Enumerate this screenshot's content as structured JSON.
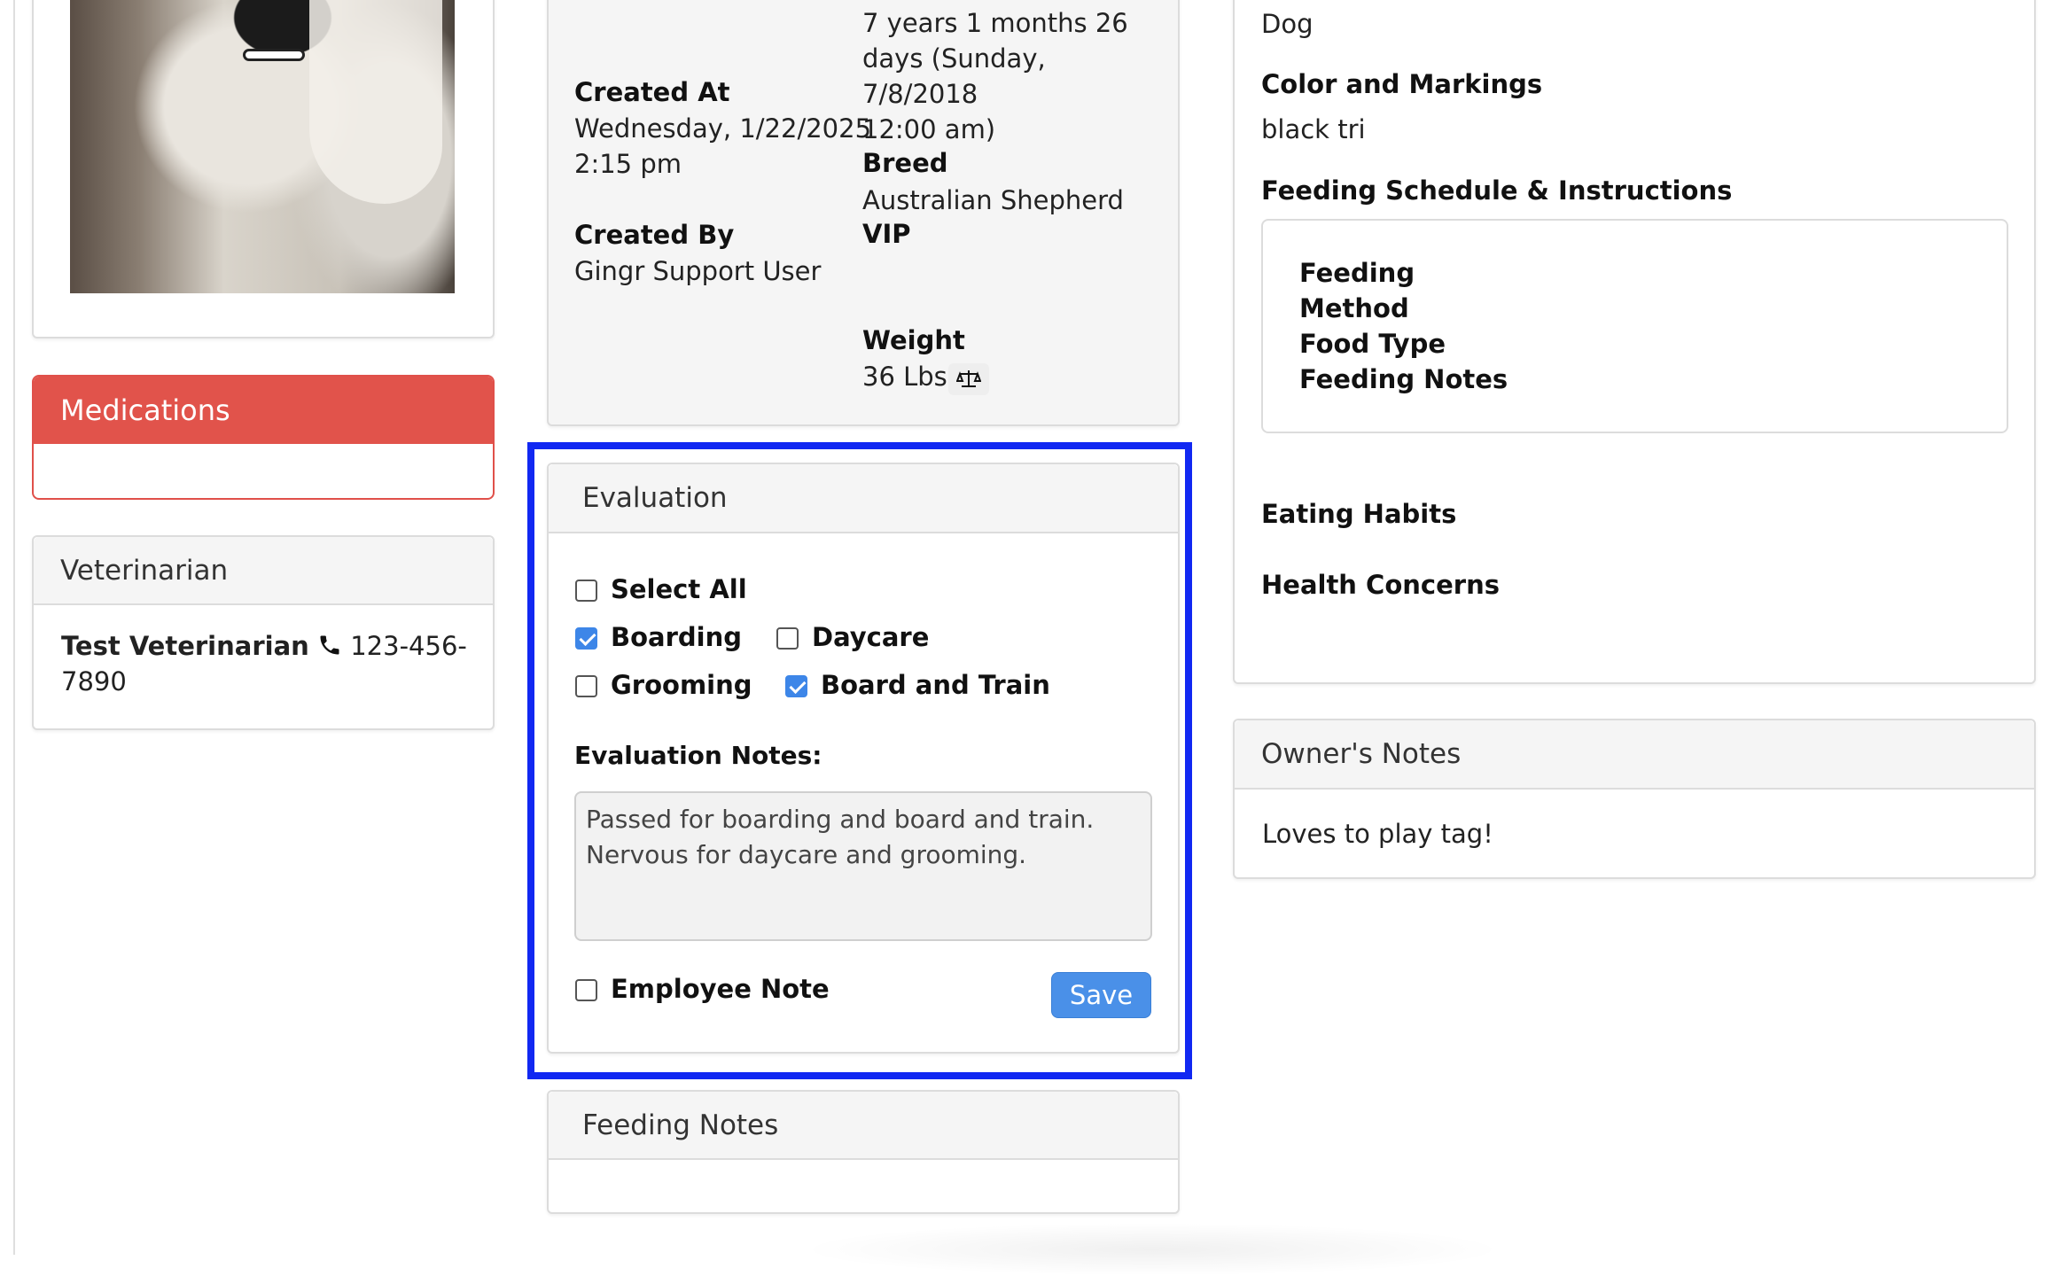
{
  "left": {
    "medications": {
      "title": "Medications"
    },
    "veterinarian": {
      "title": "Veterinarian",
      "name": "Test Veterinarian",
      "phone_line1": "123-456-",
      "phone_line2": "7890"
    }
  },
  "details": {
    "age_line1": "7 years 1 months 26",
    "age_line2": "days (Sunday, 7/8/2018",
    "age_line3": "12:00 am)",
    "created_at_label": "Created At",
    "created_at_line1": "Wednesday, 1/22/2025",
    "created_at_line2": "2:15 pm",
    "created_by_label": "Created By",
    "created_by_value": "Gingr Support User",
    "breed_label": "Breed",
    "breed_value": "Australian Shepherd",
    "vip_label": "VIP",
    "weight_label": "Weight",
    "weight_value": "36 Lbs"
  },
  "evaluation": {
    "title": "Evaluation",
    "options": [
      {
        "label": "Select All",
        "checked": false
      },
      {
        "label": "Boarding",
        "checked": true
      },
      {
        "label": "Daycare",
        "checked": false
      },
      {
        "label": "Grooming",
        "checked": false
      },
      {
        "label": "Board and Train",
        "checked": true
      }
    ],
    "notes_label": "Evaluation Notes:",
    "notes_value": "Passed for boarding and board and train.\nNervous for daycare and grooming.",
    "employee_note_label": "Employee Note",
    "employee_note_checked": false,
    "save_label": "Save"
  },
  "feeding_notes": {
    "title": "Feeding Notes"
  },
  "right": {
    "species_value": "Dog",
    "color_label": "Color and Markings",
    "color_value": "black tri",
    "feeding_schedule_label": "Feeding Schedule & Instructions",
    "feeding_fields": [
      "Feeding",
      "Method",
      "Food Type",
      "Feeding Notes"
    ],
    "eating_habits_label": "Eating Habits",
    "health_concerns_label": "Health Concerns"
  },
  "owners_notes": {
    "title": "Owner's Notes",
    "text": "Loves to play tag!"
  },
  "colors": {
    "danger": "#e1534b",
    "primary": "#4a90e8",
    "highlight": "#1128f2"
  }
}
